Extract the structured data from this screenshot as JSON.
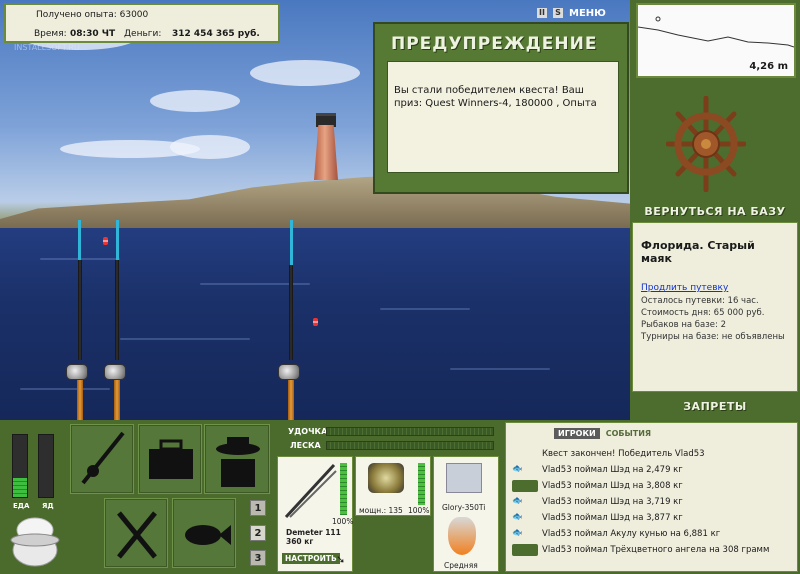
{
  "info": {
    "xp_label": "Получено опыта:",
    "xp_value": "63000",
    "time_label": "Время:",
    "time_value": "08:30 ЧТ",
    "money_label": "Деньги:",
    "money_value": "312 454 365 руб."
  },
  "watermark": "INSTALLSOFT.RU",
  "topbar": {
    "pause": "II",
    "sound": "S",
    "menu": "МЕНЮ"
  },
  "warning": {
    "title": "ПРЕДУПРЕЖДЕНИЕ",
    "message": "Вы стали победителем квеста! Ваш приз: Quest Winners-4, 180000 , Опыта"
  },
  "depth": {
    "value": "4,26 m"
  },
  "right": {
    "return_base": "ВЕРНУТЬСЯ НА БАЗУ",
    "bans": "ЗАПРЕТЫ"
  },
  "location": {
    "title": "Флорида. Старый маяк",
    "extend_link": "Продлить путевку",
    "lines": [
      "Осталось путевки: 16 час.",
      "Стоимость дня: 65 000 руб.",
      "Рыбаков на базе: 2",
      "Турниры на базе: не объявлены"
    ]
  },
  "needs": {
    "food": "ЕДА",
    "poison": "ЯД",
    "food_level": 0.3,
    "poison_level": 0.0
  },
  "slots": [
    "1",
    "2",
    "3"
  ],
  "tackle": {
    "rod_label": "УДОЧКА",
    "line_label": "ЛЕСКА",
    "rod_name": "Demeter 111",
    "rod_weight": "360 кг",
    "rod_pct": "100%",
    "reel_power": "мощн.: 135",
    "reel_pct": "100%",
    "lure_name": "Glory-350Ti",
    "lure_size": "Средняя",
    "setup_button": "НАСТРОИТЬ"
  },
  "events": {
    "tab_players": "ИГРОКИ",
    "tab_events": "СОБЫТИЯ",
    "quest_done": "Квест закончен! Победитель Vlad53",
    "items": [
      {
        "text": "Vlad53 поймал Шэд на 2,479 кг",
        "highlight": false
      },
      {
        "text": "Vlad53 поймал Шэд на 3,808 кг",
        "highlight": true
      },
      {
        "text": "Vlad53 поймал Шэд на 3,719 кг",
        "highlight": false
      },
      {
        "text": "Vlad53 поймал Шэд на 3,877 кг",
        "highlight": false
      },
      {
        "text": "Vlad53 поймал Акулу кунью на 6,881 кг",
        "highlight": false
      },
      {
        "text": "Vlad53 поймал Трёхцветного ангела на 308 грамм",
        "highlight": true
      }
    ]
  }
}
